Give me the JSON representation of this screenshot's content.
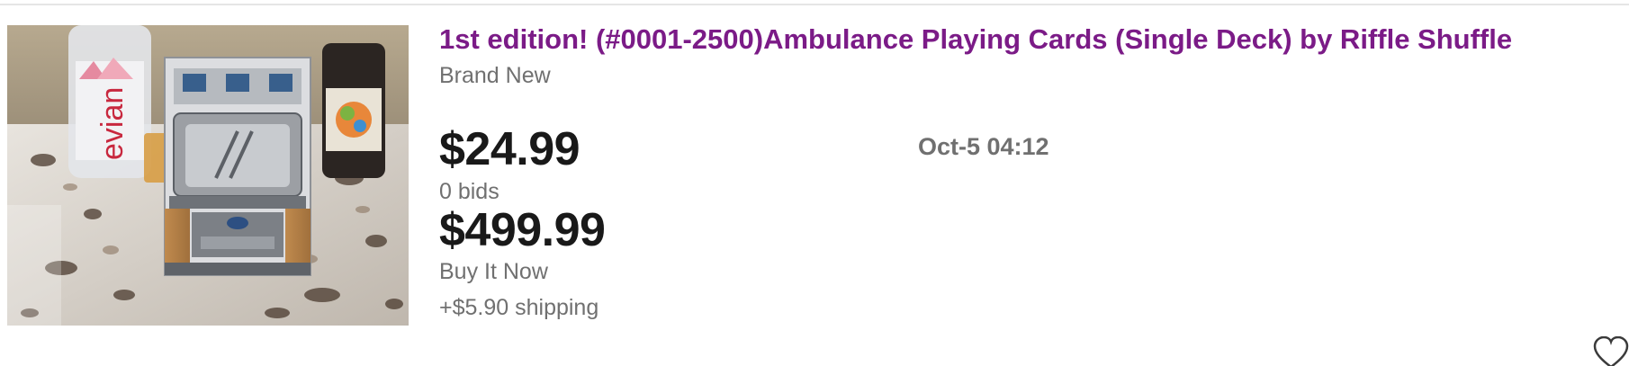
{
  "listing": {
    "title": "1st edition! (#0001-2500)Ambulance Playing Cards (Single Deck) by Riffle Shuffle",
    "condition": "Brand New",
    "current_bid_price": "$24.99",
    "bid_count": "0 bids",
    "buy_it_now_price": "$499.99",
    "buy_format": "Buy It Now",
    "shipping": "+$5.90 shipping",
    "end_time": "Oct-5 04:12",
    "image_label_bottle": "evian",
    "watch_icon": "heart-icon"
  },
  "colors": {
    "title": "#7b1b87",
    "price": "#191919",
    "secondary_text": "#707070",
    "divider": "#e5e5e5"
  }
}
